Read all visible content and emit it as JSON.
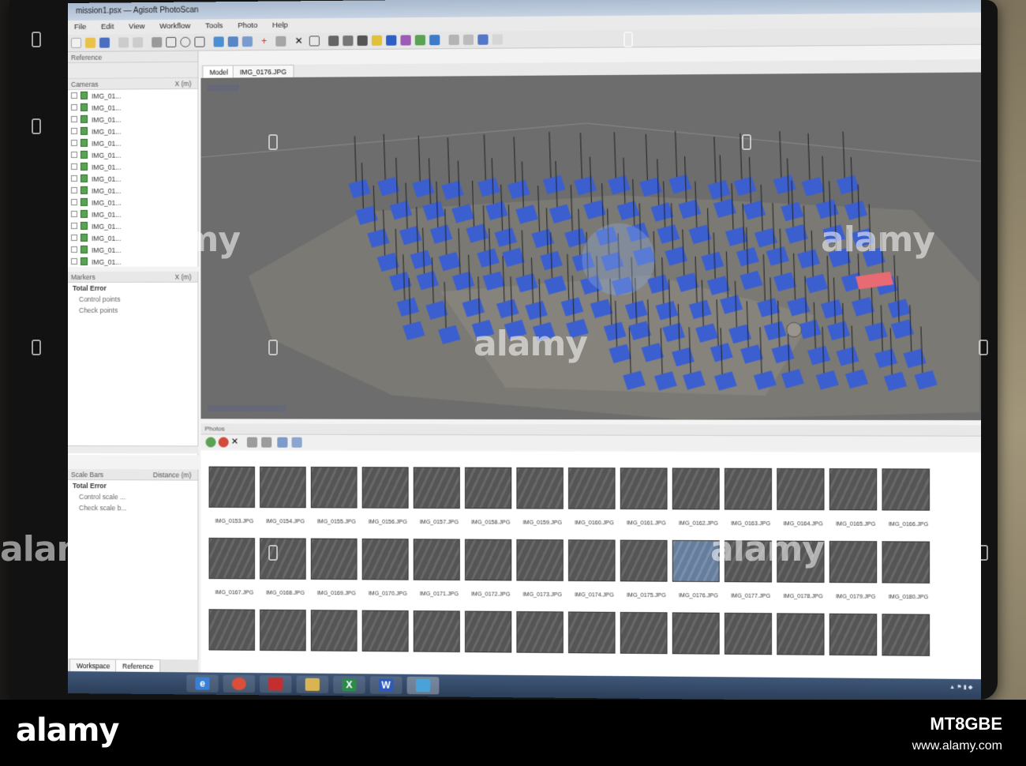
{
  "window": {
    "title": "mission1.psx — Agisoft PhotoScan",
    "menu": [
      "File",
      "Edit",
      "View",
      "Workflow",
      "Tools",
      "Photo",
      "Help"
    ]
  },
  "reference_panel": {
    "title": "Reference",
    "cameras_header": "Cameras",
    "cameras_col": "X (m)",
    "camera_labels": [
      "IMG_01...",
      "IMG_01...",
      "IMG_01...",
      "IMG_01...",
      "IMG_01...",
      "IMG_01...",
      "IMG_01...",
      "IMG_01...",
      "IMG_01...",
      "IMG_01...",
      "IMG_01...",
      "IMG_01...",
      "IMG_01...",
      "IMG_01...",
      "IMG_01..."
    ],
    "markers_header": "Markers",
    "markers_col": "X (m)",
    "markers_total": "Total Error",
    "markers_control": "Control points",
    "markers_check": "Check points",
    "scale_header": "Scale Bars",
    "scale_col": "Distance (m)",
    "scale_total": "Total Error",
    "scale_control": "Control scale ...",
    "scale_check": "Check scale b..."
  },
  "model_tabs": {
    "model": "Model",
    "image": "IMG_0176.JPG"
  },
  "photos": {
    "title": "Photos",
    "rows": [
      [
        "IMG_0153.JPG",
        "IMG_0154.JPG",
        "IMG_0155.JPG",
        "IMG_0156.JPG",
        "IMG_0157.JPG",
        "IMG_0158.JPG",
        "IMG_0159.JPG",
        "IMG_0160.JPG",
        "IMG_0161.JPG",
        "IMG_0162.JPG",
        "IMG_0163.JPG",
        "IMG_0164.JPG",
        "IMG_0165.JPG",
        "IMG_0166.JPG"
      ],
      [
        "IMG_0167.JPG",
        "IMG_0168.JPG",
        "IMG_0169.JPG",
        "IMG_0170.JPG",
        "IMG_0171.JPG",
        "IMG_0172.JPG",
        "IMG_0173.JPG",
        "IMG_0174.JPG",
        "IMG_0175.JPG",
        "IMG_0176.JPG",
        "IMG_0177.JPG",
        "IMG_0178.JPG",
        "IMG_0179.JPG",
        "IMG_0180.JPG"
      ]
    ],
    "selected": "IMG_0176.JPG"
  },
  "bottom_tabs": {
    "workspace": "Workspace",
    "reference": "Reference"
  },
  "taskbar": {
    "apps": [
      "ie-icon",
      "chrome-icon",
      "acrobat-icon",
      "explorer-icon",
      "excel-icon",
      "word-icon",
      "photoscan-icon"
    ],
    "word_letter": "W",
    "excel_letter": "X"
  },
  "watermark": {
    "text": "alamy",
    "stock_id": "MT8GBE",
    "url": "www.alamy.com"
  },
  "colors": {
    "camera_blue": "#3c5fcf",
    "selected_camera": "#e86a73",
    "ground": "#7c7a74",
    "viewport_bg": "#6d6d6d"
  }
}
